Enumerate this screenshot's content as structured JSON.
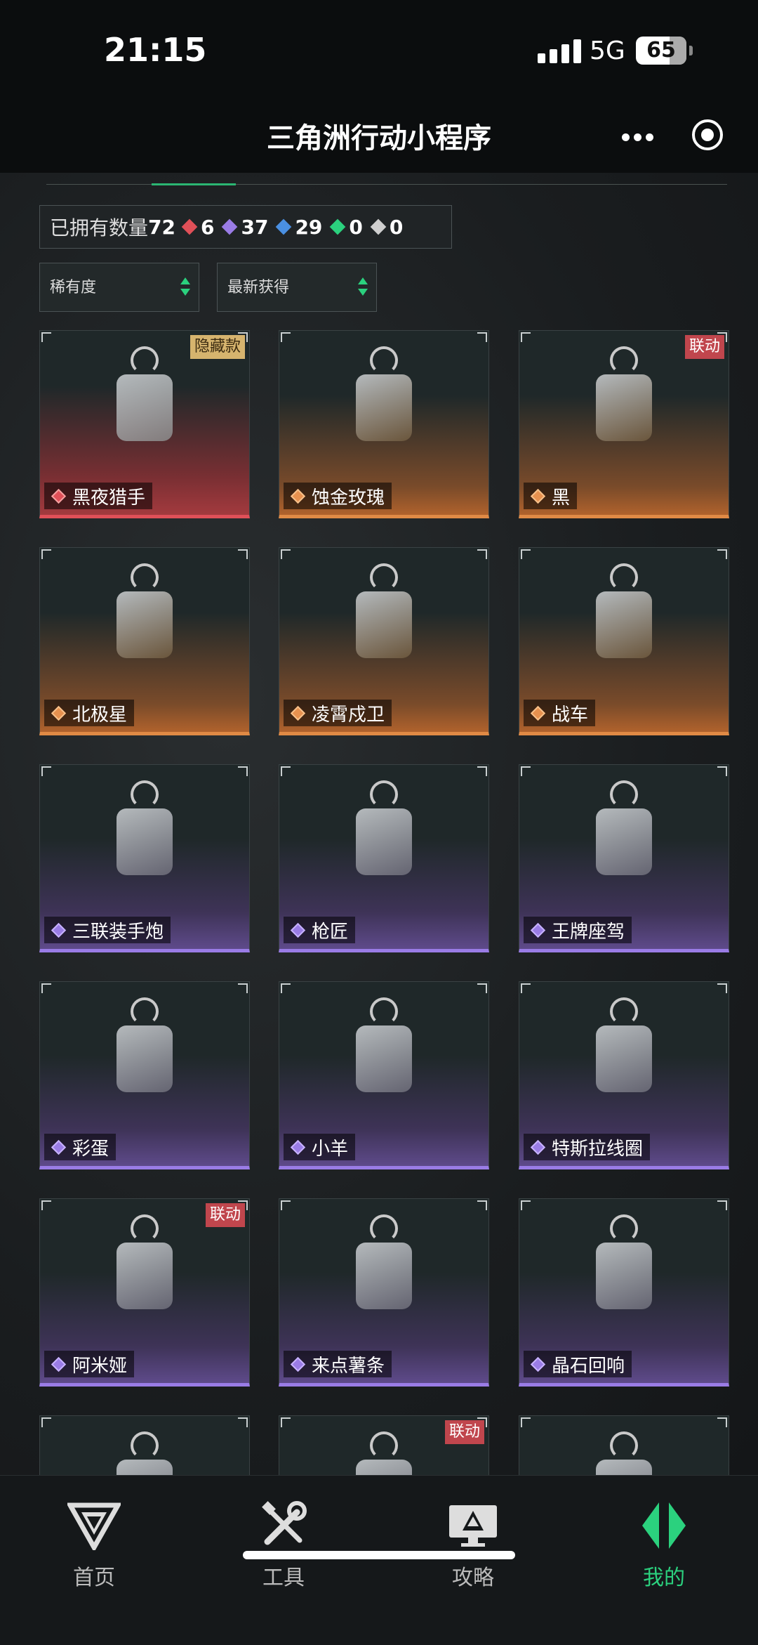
{
  "status_bar": {
    "time": "21:15",
    "network": "5G",
    "battery": "65"
  },
  "header": {
    "title": "三角洲行动小程序"
  },
  "summary": {
    "owned_label": "已拥有数量",
    "owned_total": "72",
    "rarity_counts": [
      {
        "color": "#e05058",
        "count": "6"
      },
      {
        "color": "#9a7ce6",
        "count": "37"
      },
      {
        "color": "#4a90e2",
        "count": "29"
      },
      {
        "color": "#2bd17e",
        "count": "0"
      },
      {
        "color": "#cfcfcf",
        "count": "0"
      }
    ]
  },
  "filters": {
    "sort1": "稀有度",
    "sort2": "最新获得"
  },
  "items": [
    {
      "name": "黑夜猎手",
      "rarity": "red",
      "badge": "隐藏款"
    },
    {
      "name": "蚀金玫瑰",
      "rarity": "orange",
      "badge": ""
    },
    {
      "name": "黑",
      "rarity": "orange",
      "badge": "联动"
    },
    {
      "name": "北极星",
      "rarity": "orange",
      "badge": ""
    },
    {
      "name": "凌霄戍卫",
      "rarity": "orange",
      "badge": ""
    },
    {
      "name": "战车",
      "rarity": "orange",
      "badge": ""
    },
    {
      "name": "三联装手炮",
      "rarity": "purple",
      "badge": ""
    },
    {
      "name": "枪匠",
      "rarity": "purple",
      "badge": ""
    },
    {
      "name": "王牌座驾",
      "rarity": "purple",
      "badge": ""
    },
    {
      "name": "彩蛋",
      "rarity": "purple",
      "badge": ""
    },
    {
      "name": "小羊",
      "rarity": "purple",
      "badge": ""
    },
    {
      "name": "特斯拉线圈",
      "rarity": "purple",
      "badge": ""
    },
    {
      "name": "阿米娅",
      "rarity": "purple",
      "badge": "联动"
    },
    {
      "name": "来点薯条",
      "rarity": "purple",
      "badge": ""
    },
    {
      "name": "晶石回响",
      "rarity": "purple",
      "badge": ""
    },
    {
      "name": "",
      "rarity": "purple",
      "badge": ""
    },
    {
      "name": "",
      "rarity": "purple",
      "badge": "联动"
    },
    {
      "name": "",
      "rarity": "purple",
      "badge": ""
    }
  ],
  "nav": [
    {
      "label": "首页",
      "icon": "delta-logo-icon",
      "active": false
    },
    {
      "label": "工具",
      "icon": "tools-icon",
      "active": false
    },
    {
      "label": "攻略",
      "icon": "monitor-icon",
      "active": false
    },
    {
      "label": "我的",
      "icon": "profile-logo-icon",
      "active": true
    }
  ],
  "accent_color": "#2bd17e"
}
